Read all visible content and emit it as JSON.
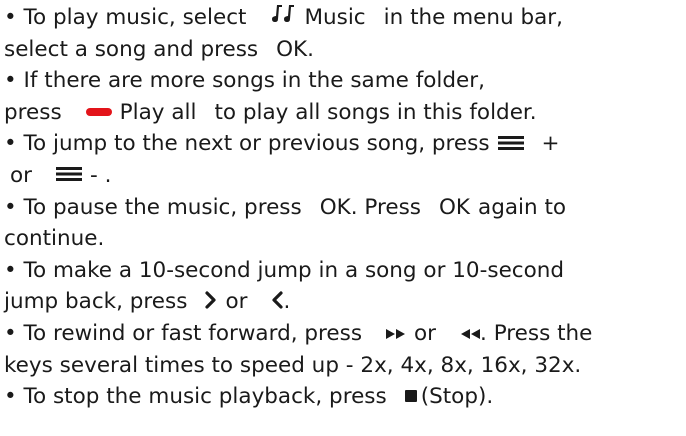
{
  "lines": [
    {
      "p1": "• To play music, select",
      "key": "Music",
      "p2": "in the menu bar,"
    },
    {
      "p1": "select a song and press",
      "key": "OK",
      "p2": "."
    },
    {
      "p1": "• If there are more songs in the same folder,"
    },
    {
      "p1": "press",
      "key": "Play all",
      "p2": "to play all songs in this folder."
    },
    {
      "p1": "• To jump to the next or previous song, press",
      "p2": "+"
    },
    {
      "p1": "or",
      "p2": "- ."
    },
    {
      "p1": "• To pause the music, press",
      "key": "OK",
      "p2": ". Press",
      "key2": "OK",
      "p3": "again to"
    },
    {
      "p1": "continue."
    },
    {
      "p1": "• To make a 10-second jump in a song or 10-second"
    },
    {
      "p1": "jump back, press",
      "p2": "or",
      "p3": "."
    },
    {
      "p1": "• To rewind or fast forward, press",
      "p2": "or",
      "p3": ". Press the"
    },
    {
      "p1": "keys several times to speed up - 2x, 4x, 8x, 16x, 32x."
    },
    {
      "p1": "• To stop the music playback, press",
      "p2": "(Stop)."
    }
  ],
  "icons": {
    "music": "music-notes-icon",
    "red": "red-button-icon",
    "list": "list-icon",
    "right": "chevron-right-icon",
    "left": "chevron-left-icon",
    "ff": "fast-forward-icon",
    "rw": "rewind-icon",
    "stop": "stop-icon"
  },
  "colors": {
    "red_key": "#e3141a"
  }
}
